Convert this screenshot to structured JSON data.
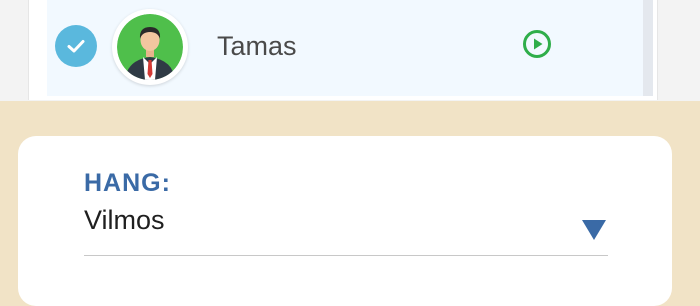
{
  "list": {
    "selected_item": {
      "name": "Tamas",
      "checked": true,
      "avatar_icon": "businessman-avatar",
      "action_icon": "play-circle-icon"
    }
  },
  "form": {
    "field_label": "HANG:",
    "field_value": "Vilmos",
    "dropdown_icon": "triangle-down-icon"
  },
  "colors": {
    "accent_blue": "#3a6aa6",
    "check_blue": "#5ab8dd",
    "play_green": "#2fae4a",
    "avatar_green": "#4fbf4b",
    "background_beige": "#f1e3c6"
  }
}
